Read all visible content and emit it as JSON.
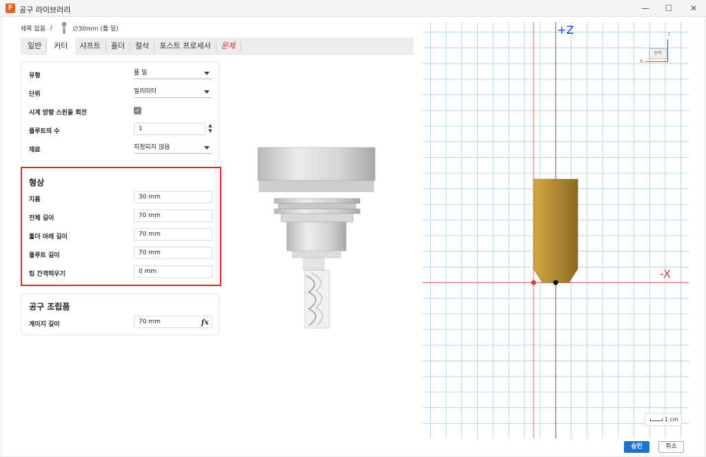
{
  "window": {
    "title": "공구 라이브러리",
    "app_icon": "F",
    "min": "—",
    "max": "☐",
    "close": "✕"
  },
  "breadcrumb": {
    "root": "제목 없음",
    "separator": "/",
    "tool": "∅30mm (플 밀)"
  },
  "tabs": [
    {
      "label": "일반"
    },
    {
      "label": "커터"
    },
    {
      "label": "샤프트"
    },
    {
      "label": "홀더"
    },
    {
      "label": "절삭"
    },
    {
      "label": "포스트 프로세서"
    },
    {
      "label": "문제"
    }
  ],
  "cutter": {
    "type_label": "유형",
    "type_value": "플 밀",
    "unit_label": "단위",
    "unit_value": "밀리미터",
    "clockwise_label": "시계 방향 스핀들 회전",
    "clockwise_checked": true,
    "check_glyph": "✓",
    "flutes_label": "플루트의 수",
    "flutes_value": "1",
    "spin_up": "▲",
    "spin_down": "▼",
    "material_label": "재료",
    "material_value": "지정되지 않음"
  },
  "geometry": {
    "title": "형상",
    "diameter_label": "지름",
    "diameter_value": "30 mm",
    "overall_length_label": "전체 길이",
    "overall_length_value": "70 mm",
    "below_holder_label": "홀더 아래 길이",
    "below_holder_value": "70 mm",
    "flute_length_label": "플루트 길이",
    "flute_length_value": "70 mm",
    "tip_offset_label": "팁 간격띄우기",
    "tip_offset_value": "0 mm"
  },
  "assembly": {
    "title": "공구 조립품",
    "gauge_label": "게이지 길이",
    "gauge_value": "70 mm",
    "fx": "fx"
  },
  "viewport": {
    "z_label": "+Z",
    "x_label": "-X",
    "viewcube_z": "Z",
    "viewcube_x": "X",
    "viewcube_face": "왼쪽"
  },
  "scale": {
    "label": "1 cm"
  },
  "buttons": {
    "ok": "승인",
    "cancel": "취소"
  },
  "colors": {
    "accent": "#1a73d1",
    "highlight": "#e32222",
    "axis_x": "#e53935",
    "axis_z": "#1a3ff0",
    "tool_body": "#b8902e"
  }
}
